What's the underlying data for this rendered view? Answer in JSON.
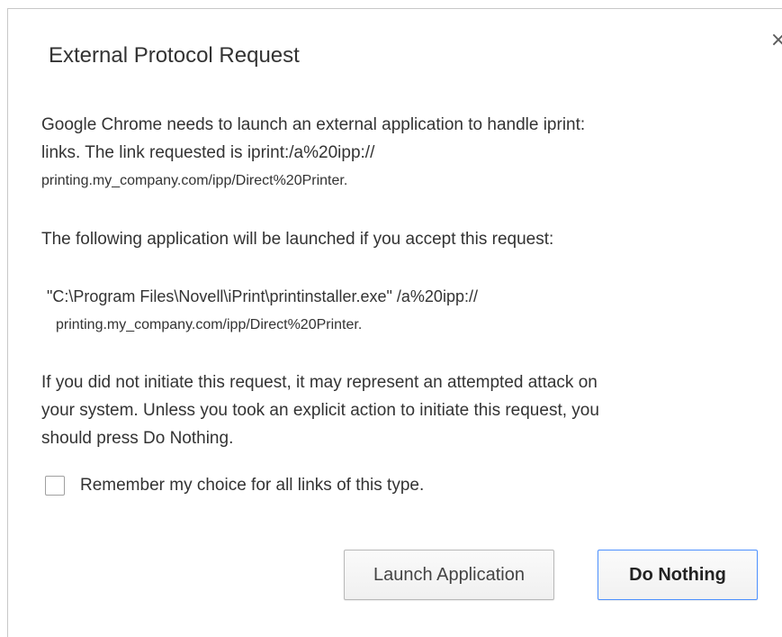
{
  "dialog": {
    "title": "External Protocol Request",
    "close_glyph": "×",
    "message_lines": [
      "Google Chrome needs to launch an external application to handle iprint:",
      "links. The link requested is iprint:/a%20ipp://",
      "printing.my_company.com/ipp/Direct%20Printer."
    ],
    "app_intro": "The following application will be launched if you accept this request:",
    "app_command_lines": [
      "\"C:\\Program Files\\Novell\\iPrint\\printinstaller.exe\" /a%20ipp://",
      "printing.my_company.com/ipp/Direct%20Printer."
    ],
    "warning_lines": [
      "If you did not initiate this request, it may represent an attempted attack on",
      "your system. Unless you took an explicit action to initiate this request, you",
      "should press Do Nothing."
    ],
    "remember_label": "Remember my choice for all links of this type.",
    "remember_checked": false,
    "launch_label": "Launch Application",
    "do_nothing_label": "Do Nothing"
  },
  "colors": {
    "text": "#333333",
    "focus_border": "#4d90fe",
    "button_border": "#b8b8b8"
  },
  "icons": {
    "close": "close-icon"
  }
}
